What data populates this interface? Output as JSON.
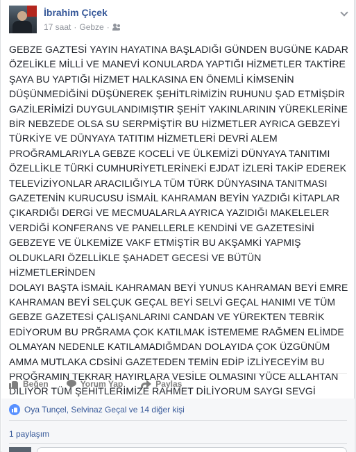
{
  "post": {
    "author": "İbrahim Çiçek",
    "time": "17 saat",
    "location": "Gebze",
    "separator": "·",
    "audience_icon": "friends-icon",
    "menu_icon": "chevron-down-icon",
    "text": "GEBZE GAZTESİ YAYIN HAYATINA BAŞLADIĞI GÜNDEN BUGÜNE KADAR\nÖZELİKLE MİLLİ VE MANEVİ KONULARDA YAPTIĞI HİZMETLER TAKTİRE\nŞAYA BU YAPTIĞI HİZMET HALKASINA EN ÖNEMLİ KİMSENİN\nDÜŞÜNMEDİĞİNİ DÜŞÜNEREK ŞEHİTLRİMİZİN RUHUNU ŞAD ETMİŞDİR\nGAZİLERİMİZİ DUYGULANDIMIŞTIR ŞEHİT YAKINLARININ YÜREKLERİNE\nBİR NEBZEDE OLSA SU SERPMİŞTİR BU HİZMETLER AYRICA GEBZEYİ\nTÜRKİYE VE DÜNYAYA TATITIM HİZMETLERİ DEVRİ ALEM\nPROĞRAMLARIYLA GEBZE KOCELİ VE ÜLKEMİZİ DÜNYAYA TANITIMI\nÖZELLİKLE TÜRKİ CUMHURİYETLERİNEKİ EJDAT İZLERİ TAKİP EDEREK\nTELEVİZİYONLAR ARACILIĞIYLA TÜM TÜRK DÜNYASINA TANITMASI\nGAZETENİN KURUCUSU İSMAİL KAHRAMAN BEYİN YAZDIĞI KİTAPLAR\nÇIKARDIĞI DERGİ VE MECMUALARLA AYRICA YAZIDIĞI MAKELELER\nVERDİĞİ KONFERANS VE PANELLERLE KENDİNİ VE GAZETESİNİ\nGEBZEYE VE ÜLKEMİZE VAKF ETMİŞTİR BU AKŞAMKİ YAPMIŞ\nOLDUKLARI ÖZELLİKLE ŞAHADET GECESİ VE BÜTÜN HİZMETLERİNDEN\nDOLAYI BAŞTA İSMAİL KAHRAMAN BEYİ YUNUS KAHRAMAN BEYİ EMRE\nKAHRAMAN BEYİ SELÇUK GEÇAL BEYİ SELVİ GEÇAL HANIMI VE TÜM\nGEBZE GAZETESİ ÇALIŞANLARINI CANDAN VE YÜREKTEN TEBRİK\nEDİYORUM BU PRĞRAMA ÇOK KATILMAK İSTEMEME RAĞMEN ELİMDE\nOLMAYAN NEDENLE KATILAMADIĞMDAN DOLAYIDA ÇOK ÜZGÜNÜM\nAMMA MUTLAKA CDSİNİ GAZETEDEN TEMİN EDİP İZLİYECEYİM BU\nPROĞRAMIN TEKRAR HAYIRLARA VESİLE OLMASINI YÜCE ALLAHTAN\nDİLİYOR TÜM ŞEHİTLERİMİZE RAHMET DİLİYORUM SAYGI SEVGİ\nHÜRMET VE MUHABBETLERİMLE"
  },
  "actions": {
    "like_label": "Beğen",
    "comment_label": "Yorum Yap",
    "share_label": "Paylaş"
  },
  "reactions": {
    "summary": "Oya Tunçel, Selvinaz Geçal ve 14 diğer kişi"
  },
  "shares": {
    "label": "1 paylaşım"
  },
  "colors": {
    "link": "#365899",
    "meta": "#90949c",
    "text": "#1d2129",
    "like_badge": "#5890ff",
    "background": "#e9ebee"
  }
}
